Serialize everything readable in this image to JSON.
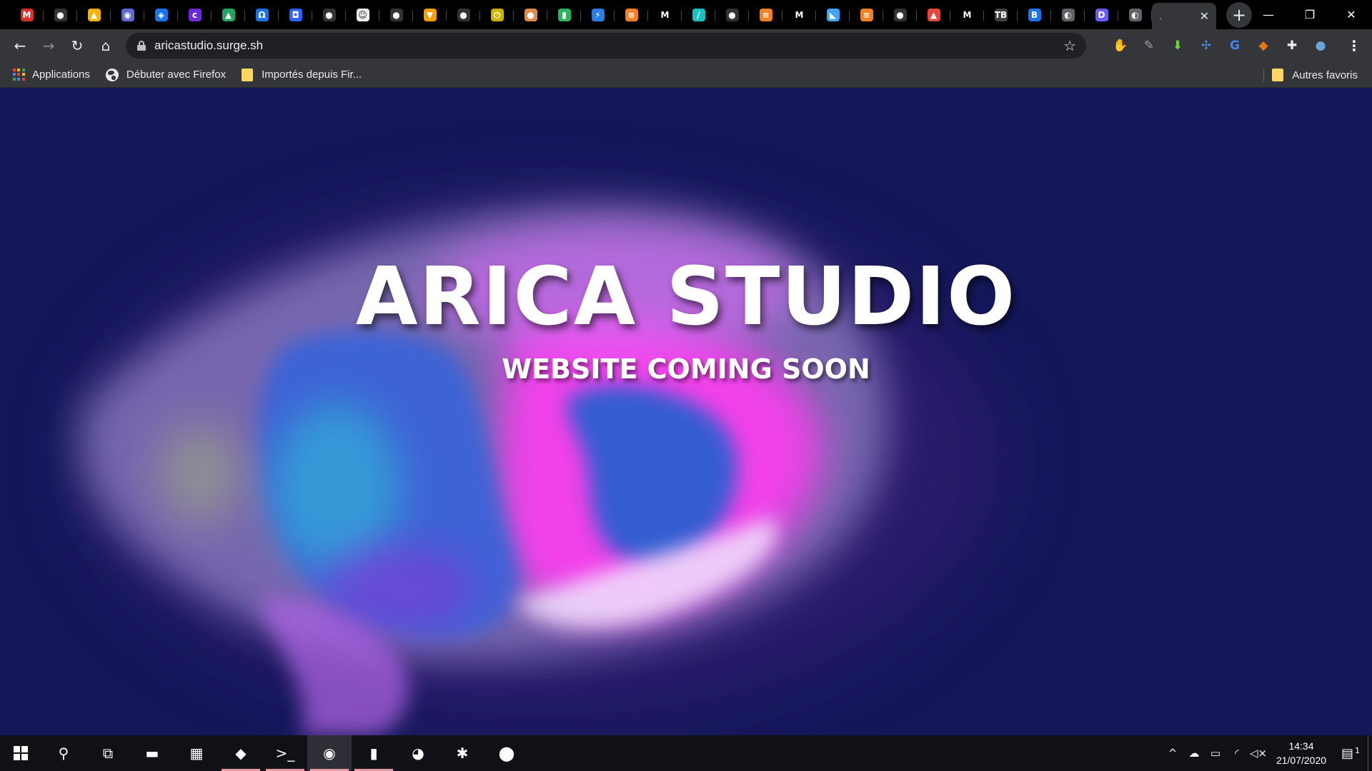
{
  "browser": {
    "tabs": [
      {
        "icon": "gmail-icon",
        "glyph": "M",
        "color": "#d93025"
      },
      {
        "icon": "github-icon",
        "glyph": "●",
        "color": "#333"
      },
      {
        "icon": "firebase-icon",
        "glyph": "▲",
        "color": "#f6b400"
      },
      {
        "icon": "tor-icon",
        "glyph": "◉",
        "color": "#5e6ad2"
      },
      {
        "icon": "network-icon",
        "glyph": "◈",
        "color": "#1a73e8"
      },
      {
        "icon": "canva-icon",
        "glyph": "c",
        "color": "#6c2bd9"
      },
      {
        "icon": "google-drive-icon",
        "glyph": "▲",
        "color": "#1fa463"
      },
      {
        "icon": "omega-icon",
        "glyph": "Ω",
        "color": "#1a73e8"
      },
      {
        "icon": "robot-icon",
        "glyph": "◘",
        "color": "#2962ff"
      },
      {
        "icon": "github-icon",
        "glyph": "●",
        "color": "#333"
      },
      {
        "icon": "face-icon",
        "glyph": "☺",
        "color": "#eee"
      },
      {
        "icon": "github-icon",
        "glyph": "●",
        "color": "#333"
      },
      {
        "icon": "graduation-cap-icon",
        "glyph": "▼",
        "color": "#f4a000"
      },
      {
        "icon": "github-icon",
        "glyph": "●",
        "color": "#333"
      },
      {
        "icon": "power-icon",
        "glyph": "⏻",
        "color": "#c8b400"
      },
      {
        "icon": "person-icon",
        "glyph": "●",
        "color": "#e08a4c"
      },
      {
        "icon": "book-icon",
        "glyph": "▮",
        "color": "#2eb35a"
      },
      {
        "icon": "lightning-icon",
        "glyph": "⚡",
        "color": "#2a7de1"
      },
      {
        "icon": "stackoverflow-icon",
        "glyph": "≡",
        "color": "#f48024"
      },
      {
        "icon": "medium-icon",
        "glyph": "M",
        "color": "#000"
      },
      {
        "icon": "slash-icon",
        "glyph": "/",
        "color": "#16c2c2"
      },
      {
        "icon": "github-icon",
        "glyph": "●",
        "color": "#333"
      },
      {
        "icon": "stackoverflow-icon",
        "glyph": "≡",
        "color": "#f48024"
      },
      {
        "icon": "medium-icon",
        "glyph": "M",
        "color": "#000"
      },
      {
        "icon": "flutter-icon",
        "glyph": "◣",
        "color": "#42a5f5"
      },
      {
        "icon": "stackoverflow-icon",
        "glyph": "≡",
        "color": "#f48024"
      },
      {
        "icon": "github-icon",
        "glyph": "●",
        "color": "#333"
      },
      {
        "icon": "fire-icon",
        "glyph": "▲",
        "color": "#e8453c"
      },
      {
        "icon": "medium-icon",
        "glyph": "M",
        "color": "#000"
      },
      {
        "icon": "tb-icon",
        "glyph": "TB",
        "color": "#3c4043"
      },
      {
        "icon": "b-icon",
        "glyph": "B",
        "color": "#1a73e8"
      },
      {
        "icon": "globe-icon",
        "glyph": "◐",
        "color": "#5f6368"
      },
      {
        "icon": "d-icon",
        "glyph": "D",
        "color": "#6b5cff"
      },
      {
        "icon": "globe-icon",
        "glyph": "◐",
        "color": "#5f6368"
      }
    ],
    "active_tab": {
      "title": ".",
      "close": "✕"
    },
    "new_tab": "+",
    "window_controls": {
      "minimize": "—",
      "maximize": "❐",
      "close": "✕"
    },
    "nav": {
      "back": "←",
      "forward": "→",
      "reload": "↻",
      "home": "⌂"
    },
    "url": "aricastudio.surge.sh",
    "bookmark_star": "☆",
    "extensions": [
      {
        "icon": "hand-stop-icon",
        "glyph": "✋",
        "color": "#e8453c"
      },
      {
        "icon": "pen-icon",
        "glyph": "✎",
        "color": "#9aa0a6"
      },
      {
        "icon": "download-arrow-icon",
        "glyph": "⬇",
        "color": "#6fcf3c"
      },
      {
        "icon": "move-icon",
        "glyph": "✢",
        "color": "#4a90e2"
      },
      {
        "icon": "translate-icon",
        "glyph": "G",
        "color": "#4285f4"
      },
      {
        "icon": "metamask-fox-icon",
        "glyph": "◆",
        "color": "#e2761b"
      },
      {
        "icon": "puzzle-icon",
        "glyph": "✚",
        "color": "#e8eaed"
      },
      {
        "icon": "profile-avatar-icon",
        "glyph": "●",
        "color": "#6aa5d8"
      }
    ],
    "menu": "⋮"
  },
  "bookmarks": {
    "apps": "Applications",
    "firefox": "Débuter avec Firefox",
    "imported": "Importés depuis Fir...",
    "others": "Autres favoris"
  },
  "page": {
    "title": "ARICA STUDIO",
    "subtitle": "WEBSITE COMING SOON"
  },
  "taskbar": {
    "apps": [
      {
        "icon": "search-icon",
        "glyph": "⚲",
        "open": false
      },
      {
        "icon": "task-view-icon",
        "glyph": "⧉",
        "open": false
      },
      {
        "icon": "file-explorer-icon",
        "glyph": "▬",
        "open": false
      },
      {
        "icon": "store-icon",
        "glyph": "▦",
        "open": false
      },
      {
        "icon": "red-diamond-app-icon",
        "glyph": "◆",
        "open": true
      },
      {
        "icon": "terminal-icon",
        "glyph": ">_",
        "open": true
      },
      {
        "icon": "chrome-icon",
        "glyph": "◉",
        "open": true
      },
      {
        "icon": "equalizer-app-icon",
        "glyph": "▮",
        "open": true
      },
      {
        "icon": "discord-icon",
        "glyph": "◕",
        "open": false
      },
      {
        "icon": "slack-icon",
        "glyph": "✱",
        "open": false
      },
      {
        "icon": "location-pin-icon",
        "glyph": "⬤",
        "open": false
      }
    ],
    "tray": {
      "chevron": "^",
      "cloud": "☁",
      "battery": "▭",
      "wifi": "◜",
      "volume": "◁×"
    },
    "time": "14:34",
    "date": "21/07/2020",
    "notifications": "▤",
    "notification_count": "1"
  }
}
